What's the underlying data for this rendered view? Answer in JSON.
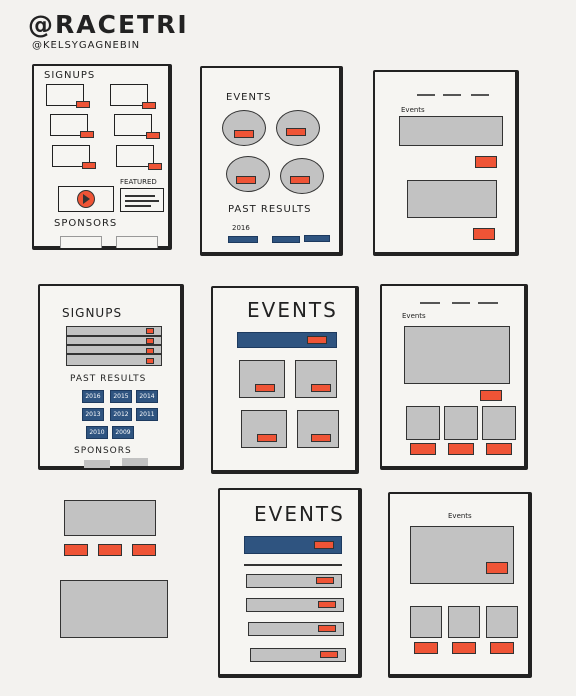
{
  "header": {
    "title": "@RACETRI",
    "handle": "@KELSYGAGNEBIN"
  },
  "frame1": {
    "signups": "SIGNUPS",
    "featured": "FEATURED",
    "sponsors": "SPONSORS"
  },
  "frame2": {
    "events": "EVENTS",
    "past_results": "PAST RESULTS",
    "year": "2016"
  },
  "frame3": {
    "events": "Events"
  },
  "frame4": {
    "signups": "SIGNUPS",
    "past_results": "PAST RESULTS",
    "sponsors": "SPONSORS",
    "years": [
      "2016",
      "2015",
      "2014",
      "2013",
      "2012",
      "2011",
      "2010",
      "2009"
    ]
  },
  "frame5": {
    "events": "EVENTS"
  },
  "frame6": {
    "events": "Events"
  },
  "frame8": {
    "events": "EVENTS"
  },
  "frame9": {
    "events": "Events"
  },
  "colors": {
    "accent": "#ef5436",
    "primary": "#2f5480",
    "placeholder": "#c2c2c2",
    "paper": "#f3f2ef"
  }
}
